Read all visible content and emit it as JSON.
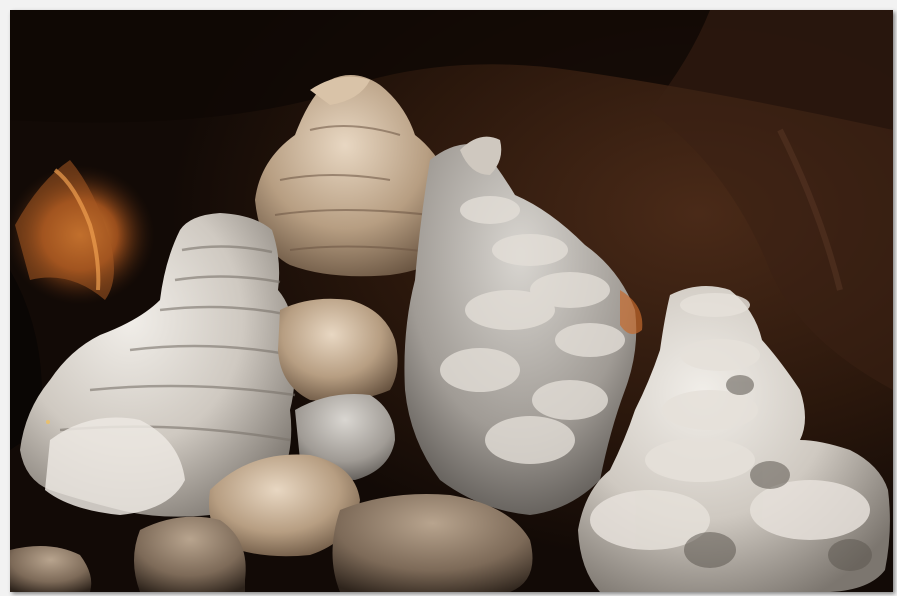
{
  "image": {
    "subject": "cave-formations",
    "colors": {
      "background": "#f2f2f2",
      "cave_dark": "#140c08",
      "rock_brown": "#3a2416",
      "warm_light": "#c8712a",
      "stalagmite_light": "#e6e2dc",
      "stalagmite_shadow": "#8f8a84",
      "stalagmite_warm": "#cdb59a"
    }
  }
}
